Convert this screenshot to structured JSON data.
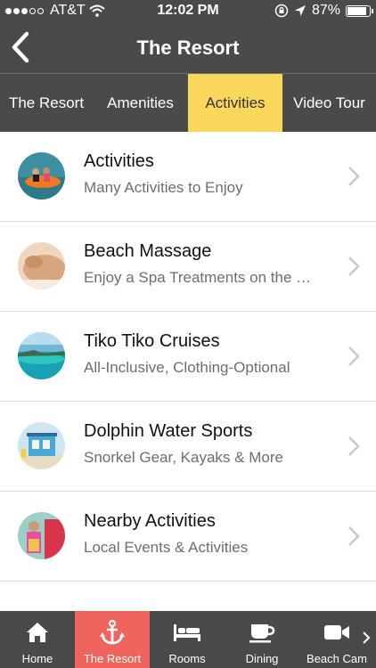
{
  "status_bar": {
    "carrier": "AT&T",
    "time": "12:02 PM",
    "battery": "87%",
    "battery_level": 0.87
  },
  "header": {
    "title": "The Resort"
  },
  "tabs": [
    {
      "label": "The Resort",
      "active": false
    },
    {
      "label": "Amenities",
      "active": false
    },
    {
      "label": "Activities",
      "active": true
    },
    {
      "label": "Video Tour",
      "active": false
    }
  ],
  "list": [
    {
      "title": "Activities",
      "subtitle": "Many Activities to Enjoy"
    },
    {
      "title": "Beach Massage",
      "subtitle": "Enjoy a Spa Treatments on the Beach"
    },
    {
      "title": "Tiko Tiko Cruises",
      "subtitle": "All-Inclusive, Clothing-Optional"
    },
    {
      "title": "Dolphin Water Sports",
      "subtitle": "Snorkel Gear, Kayaks & More"
    },
    {
      "title": "Nearby Activities",
      "subtitle": "Local Events & Activities"
    }
  ],
  "bottom_nav": [
    {
      "label": "Home",
      "icon": "home-icon"
    },
    {
      "label": "The Resort",
      "icon": "anchor-icon",
      "active": true
    },
    {
      "label": "Rooms",
      "icon": "bed-icon"
    },
    {
      "label": "Dining",
      "icon": "coffee-cup-icon"
    },
    {
      "label": "Beach Cam",
      "icon": "video-camera-icon"
    }
  ],
  "colors": {
    "bar": "#4a4a48",
    "active_tab": "#f8d75a",
    "active_nav": "#f0645e"
  }
}
